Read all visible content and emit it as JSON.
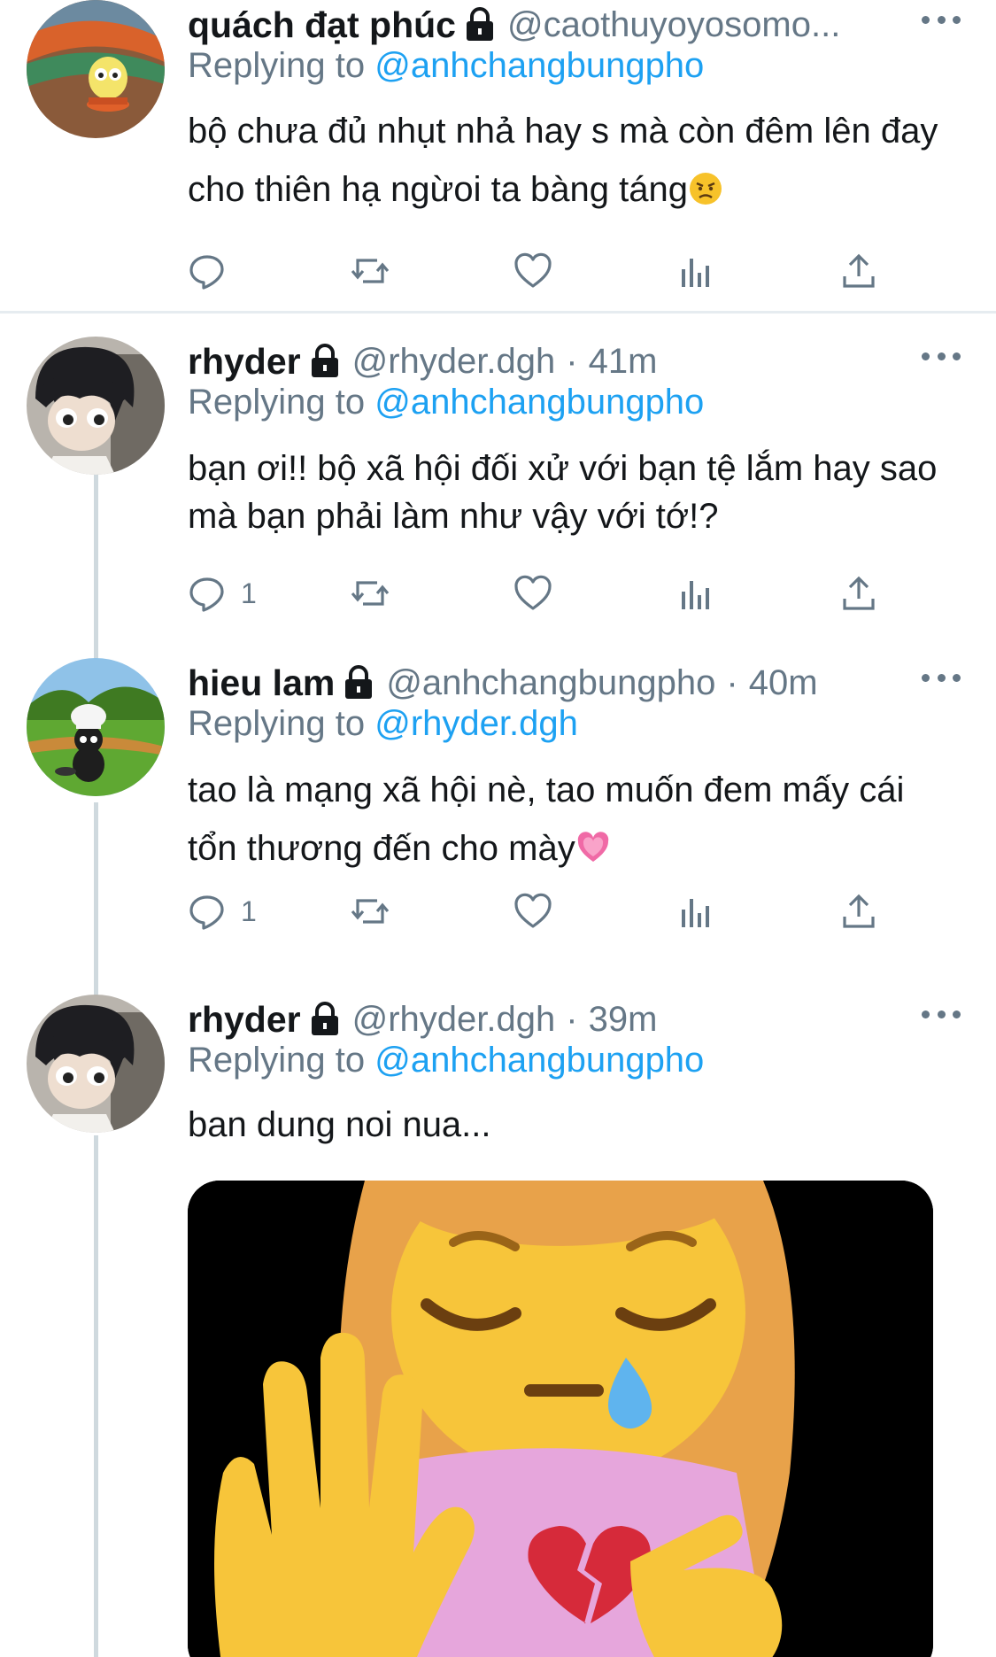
{
  "tweets": [
    {
      "name": "quách đạt phúc",
      "handle": "@caothuyoyosomo...",
      "time": "",
      "replying_label": "Replying to",
      "replying_to": "@anhchangbungpho",
      "text": "bộ chưa đủ nhụt nhả hay s mà còn đêm lên đay cho thiên hạ ngừoi ta bàng táng",
      "emoji": "angry-face-emoji",
      "reply_count": "",
      "avatar": "yellow-chick-cartoon"
    },
    {
      "name": "rhyder",
      "handle": "@rhyder.dgh",
      "time": "41m",
      "replying_label": "Replying to",
      "replying_to": "@anhchangbungpho",
      "text": "bạn ơi!! bộ xã hội đối xử với bạn tệ lắm hay sao mà bạn phải làm như vậy với tớ!?",
      "reply_count": "1",
      "avatar": "anime-boy-figure"
    },
    {
      "name": "hieu lam",
      "handle": "@anhchangbungpho",
      "time": "40m",
      "replying_label": "Replying to",
      "replying_to": "@rhyder.dgh",
      "text": "tao là mạng xã hội nè, tao muốn đem mấy cái tổn thương đến cho mày",
      "emoji": "pink-heart-emoji",
      "reply_count": "1",
      "avatar": "chef-character-field"
    },
    {
      "name": "rhyder",
      "handle": "@rhyder.dgh",
      "time": "39m",
      "replying_label": "Replying to",
      "replying_to": "@anhchangbungpho",
      "text": "ban dung noi nua...",
      "reply_count": "",
      "avatar": "anime-boy-figure",
      "media": "sad-girl-stop-hand-broken-heart-emoji"
    }
  ],
  "colors": {
    "link": "#1da1f2",
    "secondary_text": "#657786",
    "primary_text": "#14171a",
    "divider": "#e6ecf0",
    "thread_line": "#cfd9de"
  },
  "action_icons": [
    "reply-icon",
    "retweet-icon",
    "like-icon",
    "analytics-icon",
    "share-icon"
  ]
}
